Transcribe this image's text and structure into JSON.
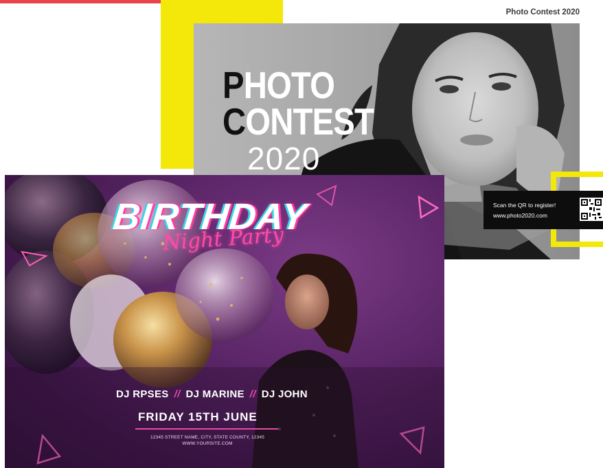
{
  "photo_contest": {
    "header": "Photo Contest 2020",
    "title_line1_initial": "P",
    "title_line1_rest": "HOTO",
    "title_line2_initial": "C",
    "title_line2_rest": "ONTEST",
    "year": "2020",
    "qr_text": "Scan the QR to register!",
    "website": "www.photo2020.com"
  },
  "birthday": {
    "title": "BIRTHDAY",
    "subtitle": "Night Party",
    "djs": [
      "DJ RPSES",
      "DJ MARINE",
      "DJ JOHN"
    ],
    "separator": "//",
    "date": "FRIDAY 15TH JUNE",
    "address": "12345 STREET NAME, CITY, STATE COUNTY, 12345",
    "website": "WWW.YOURSITE.COM"
  },
  "colors": {
    "accent_yellow": "#f4e80a",
    "accent_pink": "#e64aa4",
    "accent_cyan": "#39d4e6",
    "top_strip": "#e8444c"
  }
}
